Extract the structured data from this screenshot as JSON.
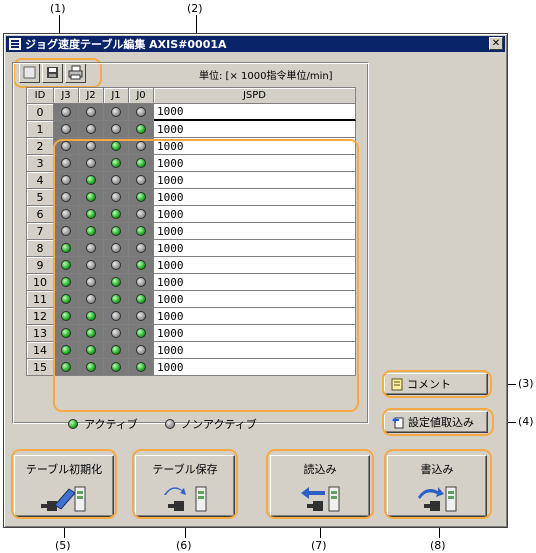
{
  "callouts": {
    "c1": "(1)",
    "c2": "(2)",
    "c3": "(3)",
    "c4": "(4)",
    "c5": "(5)",
    "c6": "(6)",
    "c7": "(7)",
    "c8": "(8)"
  },
  "window": {
    "title": "ジョグ速度テーブル編集 AXIS#0001A",
    "close_glyph": "✕"
  },
  "toolbar": {
    "icons": [
      "new-icon",
      "save-icon",
      "print-icon"
    ]
  },
  "unit_label": "単位: [× 1000指令単位/min]",
  "table": {
    "headers": [
      "ID",
      "J3",
      "J2",
      "J1",
      "J0",
      "JSPD"
    ],
    "rows": [
      {
        "id": "0",
        "bits": [
          0,
          0,
          0,
          0
        ],
        "jspd": "1000"
      },
      {
        "id": "1",
        "bits": [
          0,
          0,
          0,
          1
        ],
        "jspd": "1000"
      },
      {
        "id": "2",
        "bits": [
          0,
          0,
          1,
          0
        ],
        "jspd": "1000"
      },
      {
        "id": "3",
        "bits": [
          0,
          0,
          1,
          1
        ],
        "jspd": "1000"
      },
      {
        "id": "4",
        "bits": [
          0,
          1,
          0,
          0
        ],
        "jspd": "1000"
      },
      {
        "id": "5",
        "bits": [
          0,
          1,
          0,
          1
        ],
        "jspd": "1000"
      },
      {
        "id": "6",
        "bits": [
          0,
          1,
          1,
          0
        ],
        "jspd": "1000"
      },
      {
        "id": "7",
        "bits": [
          0,
          1,
          1,
          1
        ],
        "jspd": "1000"
      },
      {
        "id": "8",
        "bits": [
          1,
          0,
          0,
          0
        ],
        "jspd": "1000"
      },
      {
        "id": "9",
        "bits": [
          1,
          0,
          0,
          1
        ],
        "jspd": "1000"
      },
      {
        "id": "10",
        "bits": [
          1,
          0,
          1,
          0
        ],
        "jspd": "1000"
      },
      {
        "id": "11",
        "bits": [
          1,
          0,
          1,
          1
        ],
        "jspd": "1000"
      },
      {
        "id": "12",
        "bits": [
          1,
          1,
          0,
          0
        ],
        "jspd": "1000"
      },
      {
        "id": "13",
        "bits": [
          1,
          1,
          0,
          1
        ],
        "jspd": "1000"
      },
      {
        "id": "14",
        "bits": [
          1,
          1,
          1,
          0
        ],
        "jspd": "1000"
      },
      {
        "id": "15",
        "bits": [
          1,
          1,
          1,
          1
        ],
        "jspd": "1000"
      }
    ]
  },
  "legend": {
    "active": "アクティブ",
    "inactive": "ノンアクティブ"
  },
  "side_buttons": {
    "comment": "コメント",
    "read_settings": "設定値取込み"
  },
  "bottom_buttons": {
    "init": "テーブル初期化",
    "save": "テーブル保存",
    "read": "読込み",
    "write": "書込み"
  },
  "colors": {
    "highlight": "#f4a944",
    "active_led": "#22b022",
    "inactive_led": "#9a9a9a",
    "titlebar": "#0a246a"
  }
}
